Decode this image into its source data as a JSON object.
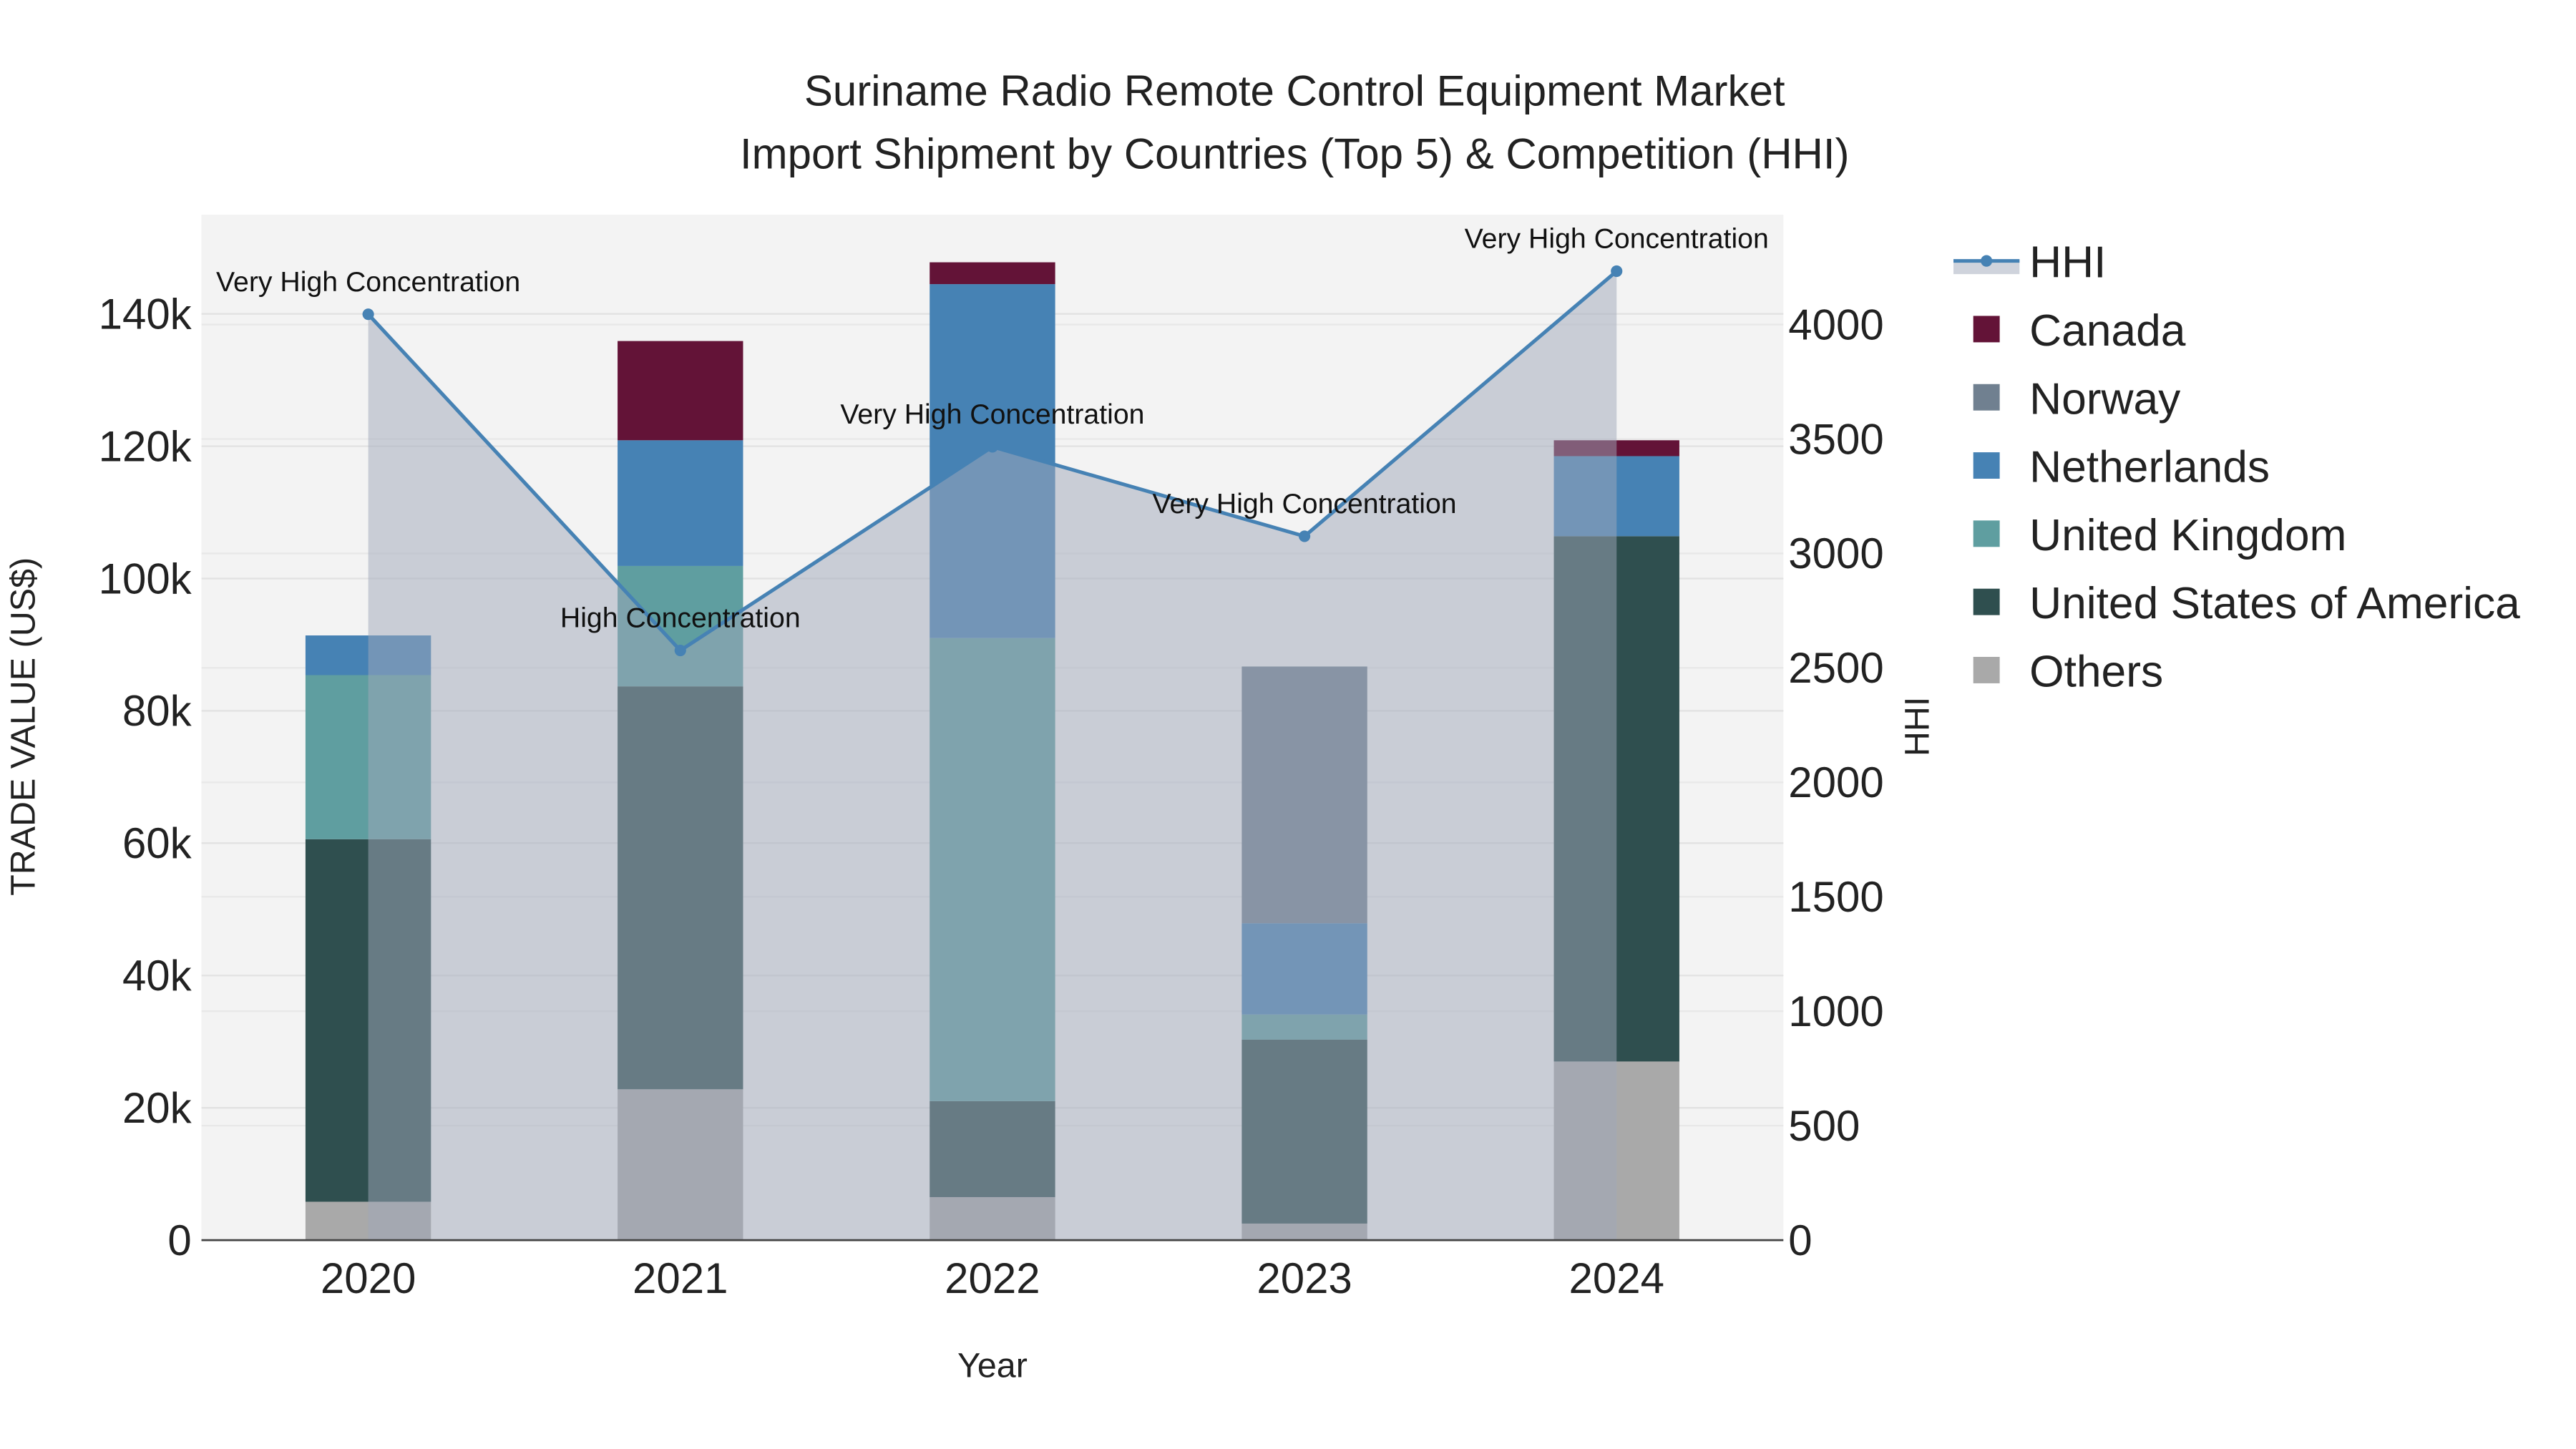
{
  "chart_data": {
    "type": "bar",
    "stacked": true,
    "title": "Suriname Radio Remote Control Equipment Market",
    "subtitle": "Import Shipment by Countries (Top 5) & Competition (HHI)",
    "xlabel": "Year",
    "ylabel": "TRADE VALUE (US$)",
    "y2label": "HHI",
    "categories": [
      "2020",
      "2021",
      "2022",
      "2023",
      "2024"
    ],
    "ylim": [
      0,
      155000
    ],
    "y_ticks": [
      0,
      20000,
      40000,
      60000,
      80000,
      100000,
      120000,
      140000
    ],
    "y_tick_labels": [
      "0",
      "20k",
      "40k",
      "60k",
      "80k",
      "100k",
      "120k",
      "140k"
    ],
    "y2lim": [
      0,
      4480
    ],
    "y2_ticks": [
      0,
      500,
      1000,
      1500,
      2000,
      2500,
      3000,
      3500,
      4000
    ],
    "y2_tick_labels": [
      "0",
      "500",
      "1000",
      "1500",
      "2000",
      "2500",
      "3000",
      "3500",
      "4000"
    ],
    "series": [
      {
        "name": "Others",
        "color": "#a9a9a9",
        "values": [
          5800,
          22800,
          6500,
          2500,
          27000
        ]
      },
      {
        "name": "United States of America",
        "color": "#2f4f4f",
        "values": [
          54800,
          60900,
          14500,
          27800,
          79400
        ]
      },
      {
        "name": "United Kingdom",
        "color": "#5f9ea0",
        "values": [
          24800,
          18200,
          70000,
          3800,
          0
        ]
      },
      {
        "name": "Netherlands",
        "color": "#4682b4",
        "values": [
          6000,
          19000,
          53500,
          13800,
          12100
        ]
      },
      {
        "name": "Norway",
        "color": "#708090",
        "values": [
          0,
          0,
          0,
          38800,
          0
        ]
      },
      {
        "name": "Canada",
        "color": "#631337",
        "values": [
          0,
          15000,
          3300,
          0,
          2400
        ]
      }
    ],
    "hhi": {
      "name": "HHI",
      "color": "#4682b4",
      "values": [
        4045,
        2576,
        3466,
        3075,
        4233
      ],
      "annotations": [
        "Very High Concentration",
        "High Concentration",
        "Very High Concentration",
        "Very High Concentration",
        "Very High Concentration"
      ]
    },
    "legend_order": [
      "HHI",
      "Canada",
      "Norway",
      "Netherlands",
      "United Kingdom",
      "United States of America",
      "Others"
    ],
    "legend_placement": "right",
    "grid": true
  }
}
